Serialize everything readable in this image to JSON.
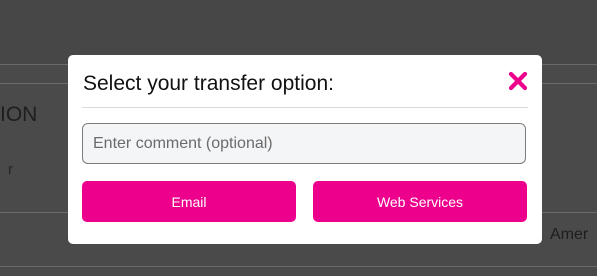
{
  "background": {
    "heading_fragment": "ION",
    "sub_fragment": "r",
    "cell_fragment": "Amer"
  },
  "dialog": {
    "title": "Select your transfer option:",
    "close_icon": "close-x-icon",
    "comment": {
      "value": "",
      "placeholder": "Enter comment (optional)"
    },
    "buttons": {
      "email_label": "Email",
      "web_services_label": "Web Services"
    }
  },
  "colors": {
    "accent": "#ec008c",
    "overlay": "#4a4a4a",
    "dialog_bg": "#ffffff"
  }
}
